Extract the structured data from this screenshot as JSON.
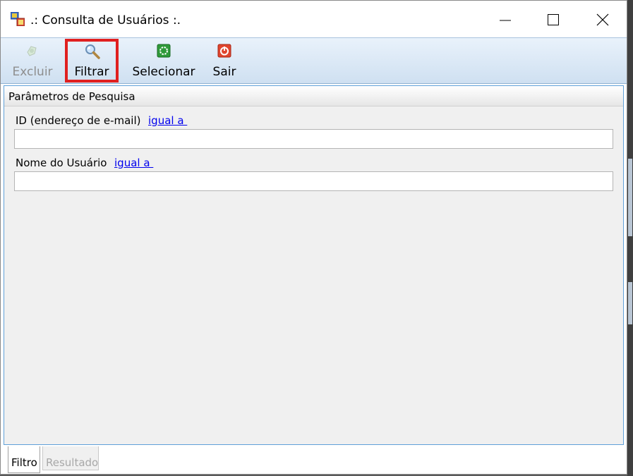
{
  "window": {
    "title": ".: Consulta de Usuários :.",
    "icon": "app-window-icon"
  },
  "controls": {
    "minimize": "minimize-icon",
    "maximize": "maximize-icon",
    "close": "close-icon"
  },
  "toolbar": {
    "buttons": [
      {
        "label": "Excluir",
        "icon": "delete-icon",
        "enabled": false
      },
      {
        "label": "Filtrar",
        "icon": "magnifier-icon",
        "enabled": true,
        "highlighted": true
      },
      {
        "label": "Selecionar",
        "icon": "select-icon",
        "enabled": true
      },
      {
        "label": "Sair",
        "icon": "exit-icon",
        "enabled": true
      }
    ]
  },
  "panel": {
    "title": "Parâmetros de Pesquisa",
    "fields": [
      {
        "label": "ID (endereço de e-mail)",
        "operator": "igual a ",
        "value": ""
      },
      {
        "label": "Nome do Usuário",
        "operator": "igual a ",
        "value": ""
      }
    ]
  },
  "tabs": [
    {
      "label": "Filtro",
      "active": true
    },
    {
      "label": "Resultado",
      "active": false
    }
  ],
  "colors": {
    "highlight": "#e02020",
    "link": "#0000ee",
    "panel_border": "#5fa0d8"
  }
}
